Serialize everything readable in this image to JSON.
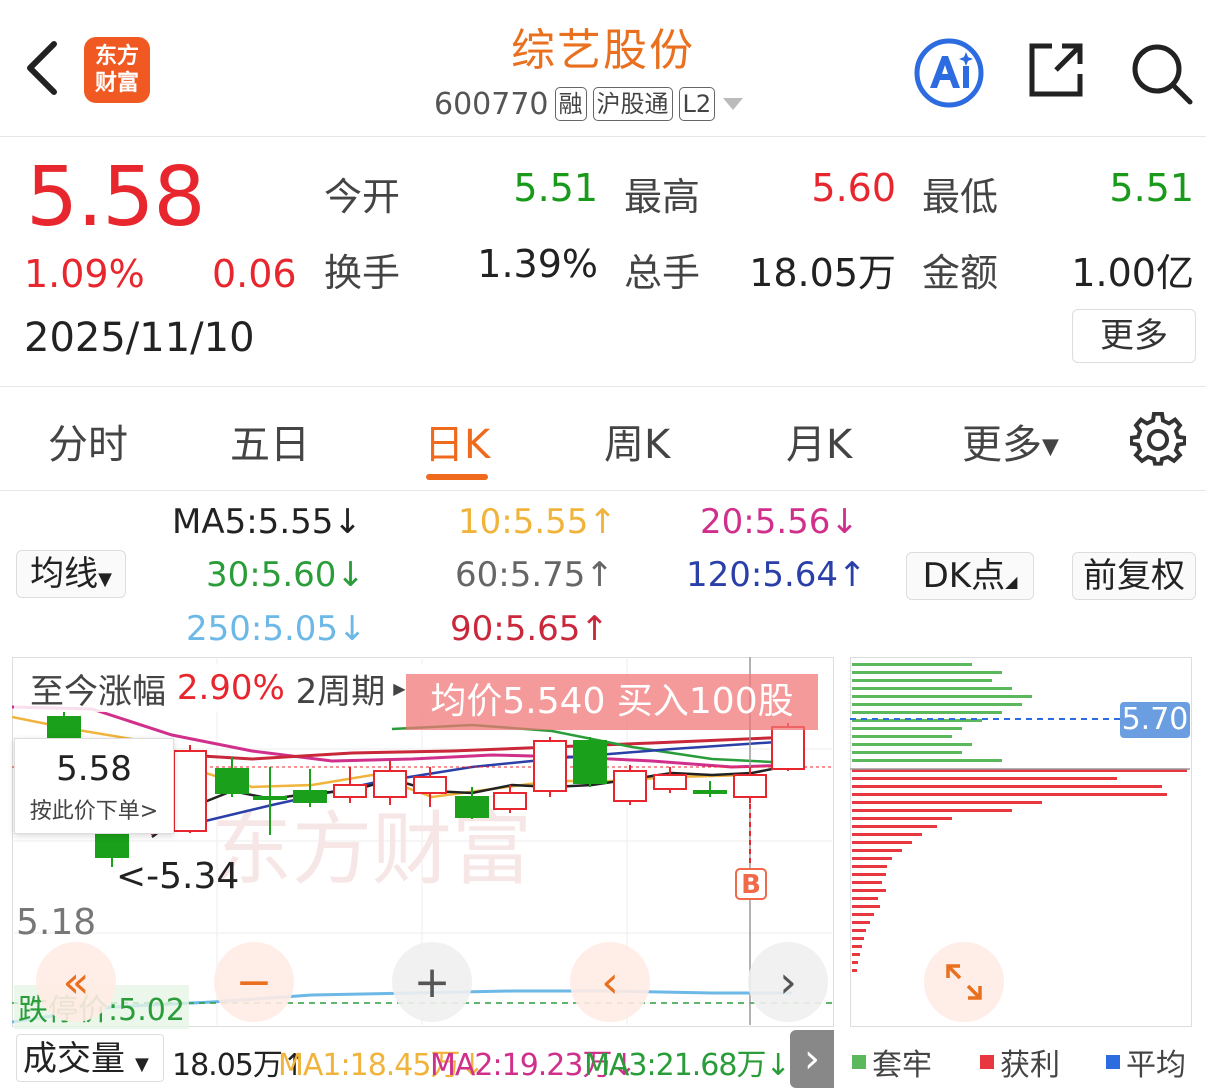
{
  "header": {
    "logo_line1": "东方",
    "logo_line2": "财富",
    "stock_name": "综艺股份",
    "code": "600770",
    "tags": [
      "融",
      "沪股通",
      "L2"
    ]
  },
  "quote": {
    "price": "5.58",
    "change_pct": "1.09%",
    "change": "0.06",
    "date": "2025/11/10",
    "open_label": "今开",
    "open": "5.51",
    "high_label": "最高",
    "high": "5.60",
    "low_label": "最低",
    "low": "5.51",
    "turnover_label": "换手",
    "turnover": "1.39%",
    "volume_label": "总手",
    "volume": "18.05万",
    "amount_label": "金额",
    "amount": "1.00亿",
    "more": "更多"
  },
  "tabs": [
    "分时",
    "五日",
    "日K",
    "周K",
    "月K",
    "更多"
  ],
  "active_tab": "日K",
  "ma": {
    "selector": "均线",
    "ma5": "MA5:5.55↓",
    "ma10": "10:5.55↑",
    "ma20": "20:5.56↓",
    "ma30": "30:5.60↓",
    "ma60": "60:5.75↑",
    "ma120": "120:5.64↑",
    "ma250": "250:5.05↓",
    "ma90": "90:5.65↑",
    "dk_button": "DK点",
    "adjust_button": "前复权",
    "colors": {
      "ma5": "#222222",
      "ma10": "#f0b43c",
      "ma20": "#d0308c",
      "ma30": "#2a9d3a",
      "ma60": "#666666",
      "ma120": "#2b3fa8",
      "ma250": "#6cb8e6",
      "ma90": "#c8283a"
    }
  },
  "chart": {
    "range_prefix": "至今涨幅",
    "range_value": "2.90%",
    "range_period": "2周期",
    "avg_banner": "均价5.540  买入100股",
    "order_price": "5.58",
    "order_label": "按此价下单>",
    "low_marker": "<-5.34",
    "y_label_518": "5.18",
    "limit_down": "跌停价:5.02",
    "dist_price": "5.70",
    "buy_marker": "B",
    "colors": {
      "up": "#e8262e",
      "down": "#1aa01a"
    }
  },
  "volume": {
    "selector": "成交量",
    "vol": "18.05万↑",
    "ma1": "MA1:18.45万↓",
    "ma2": "MA2:19.23万↓",
    "ma3": "MA3:21.68万↓"
  },
  "legend": {
    "trapped": "套牢",
    "profit": "获利",
    "average": "平均"
  }
}
